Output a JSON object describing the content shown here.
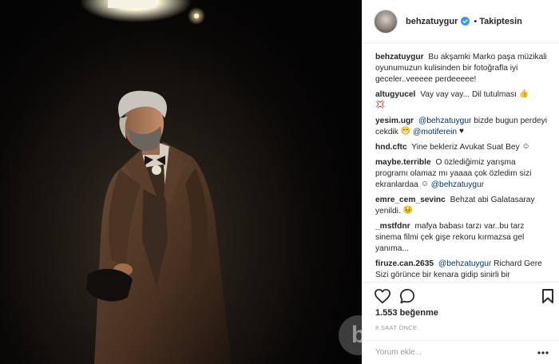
{
  "post": {
    "image_alt": "",
    "username": "behzatuygur",
    "separator": "•",
    "follow_status": "Takiptesin",
    "likes": "1.553 beğenme",
    "timestamp": "8 SAAT ÖNCE",
    "comment_placeholder": "Yorum ekle...",
    "watermark": "b"
  },
  "comments": [
    {
      "user": "behzatuygur",
      "text": "Bu akşamki Marko paşa müzikali oyunumuzun kulisinden bir fotoğrafla iyi geceler..veeeee perdeeeee!"
    },
    {
      "user": "altugyucel",
      "text": "Vay vay vay... Dil tutulması",
      "emoji": "👍",
      "emoji2": "💢"
    },
    {
      "user": "yesim.ugr",
      "mention": "@behzatuygur",
      "text": "bizde bugun perdeyi cekdik",
      "emoji": "😁",
      "mention2": "@motiferein",
      "emoji2": "♥"
    },
    {
      "user": "hnd.cftc",
      "text": "Yine bekleriz Avukat Suat Bey",
      "emoji": "☺"
    },
    {
      "user": "maybe.terrible",
      "text": "O özlediğimiz yarışma programı olamaz mı yaaaa çok özledim sizi ekranlardaa",
      "emoji": "☺",
      "mention": "@behzatuygur"
    },
    {
      "user": "emre_cem_sevinc",
      "text": "Behzat abi Galatasaray yenildi.",
      "emoji": "😣"
    },
    {
      "user": "_mstfdnr",
      "text": "mafya babası tarzı var..bu tarz sinema filmi çek gişe rekoru kırmazsa gel yanıma..."
    },
    {
      "user": "firuze.can.2635",
      "mention": "@behzatuygur",
      "text": "Richard Gere Sizi görünce bir kenara gidip sinirli bir"
    }
  ],
  "icons": {
    "like": "heart-icon",
    "comment": "comment-icon",
    "save": "bookmark-icon",
    "more": "more-icon",
    "verified": "verified-badge-icon"
  },
  "colors": {
    "verified": "#3897f0",
    "mention": "#003569",
    "muted": "#999999",
    "text": "#262626"
  }
}
